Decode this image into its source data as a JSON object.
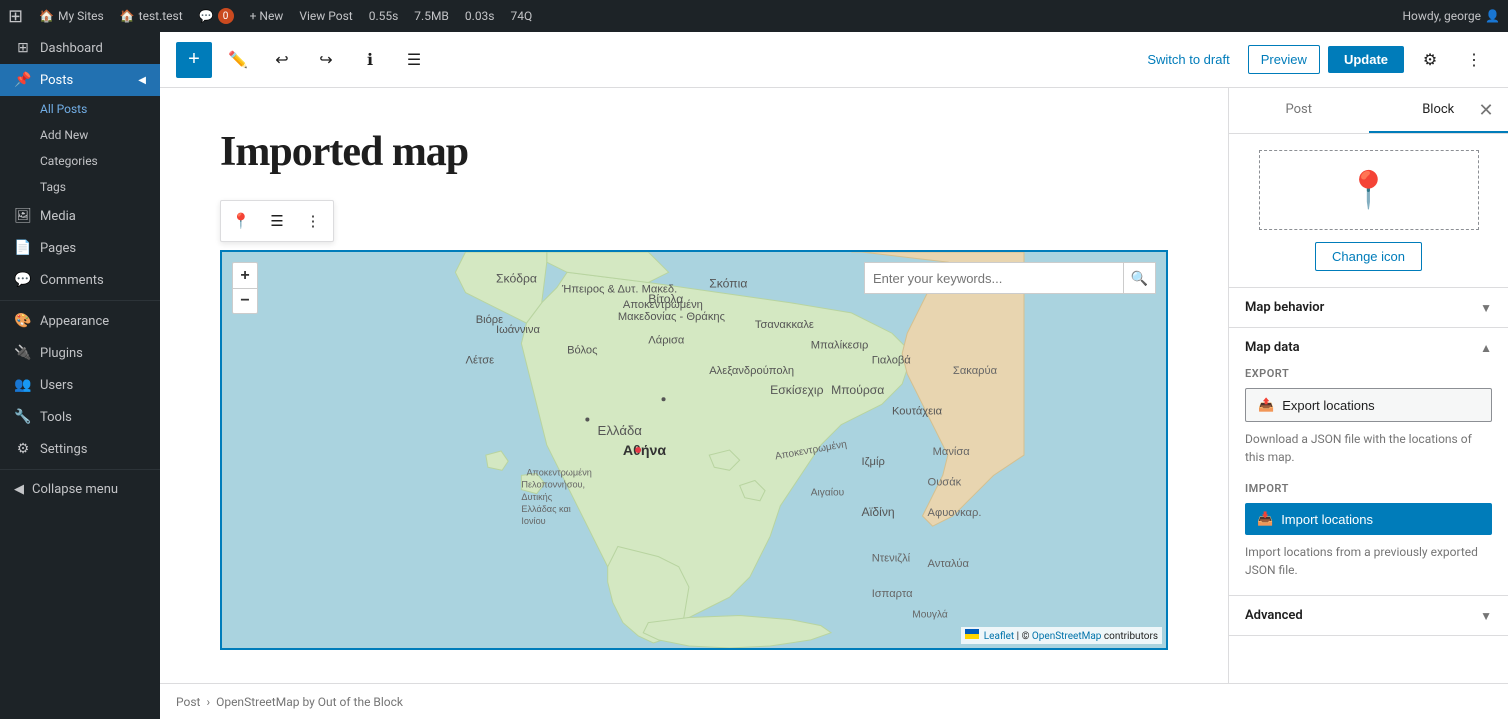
{
  "adminbar": {
    "wp_label": "WordPress",
    "my_sites": "My Sites",
    "site_name": "test.test",
    "comment_count": "0",
    "new_label": "+ New",
    "view_post": "View Post",
    "perf_1": "0.55s",
    "perf_2": "7.5MB",
    "perf_3": "0.03s",
    "perf_4": "74Q",
    "howdy": "Howdy, george"
  },
  "sidebar": {
    "dashboard": "Dashboard",
    "posts": "Posts",
    "all_posts": "All Posts",
    "add_new": "Add New",
    "categories": "Categories",
    "tags": "Tags",
    "media": "Media",
    "pages": "Pages",
    "comments": "Comments",
    "appearance": "Appearance",
    "plugins": "Plugins",
    "users": "Users",
    "tools": "Tools",
    "settings": "Settings",
    "collapse": "Collapse menu"
  },
  "toolbar": {
    "switch_to_draft": "Switch to draft",
    "preview": "Preview",
    "update": "Update"
  },
  "post": {
    "title": "Imported map"
  },
  "block_toolbar": {
    "icon1": "📍",
    "icon2": "☰",
    "icon3": "⋮"
  },
  "map": {
    "search_placeholder": "Enter your keywords...",
    "zoom_in": "+",
    "zoom_out": "−",
    "attribution_leaflet": "Leaflet",
    "attribution_osm": "OpenStreetMap",
    "attribution_contributors": " contributors"
  },
  "right_panel": {
    "tab_post": "Post",
    "tab_block": "Block",
    "change_icon_label": "Change icon",
    "map_behavior_label": "Map behavior",
    "map_data_label": "Map data",
    "export_section_label": "EXPORT",
    "export_btn_label": "Export locations",
    "export_desc": "Download a JSON file with the locations of this map.",
    "import_section_label": "IMPORT",
    "import_btn_label": "Import locations",
    "import_desc": "Import locations from a previously exported JSON file.",
    "advanced_label": "Advanced"
  },
  "breadcrumb": {
    "post": "Post",
    "block": "OpenStreetMap by Out of the Block"
  }
}
